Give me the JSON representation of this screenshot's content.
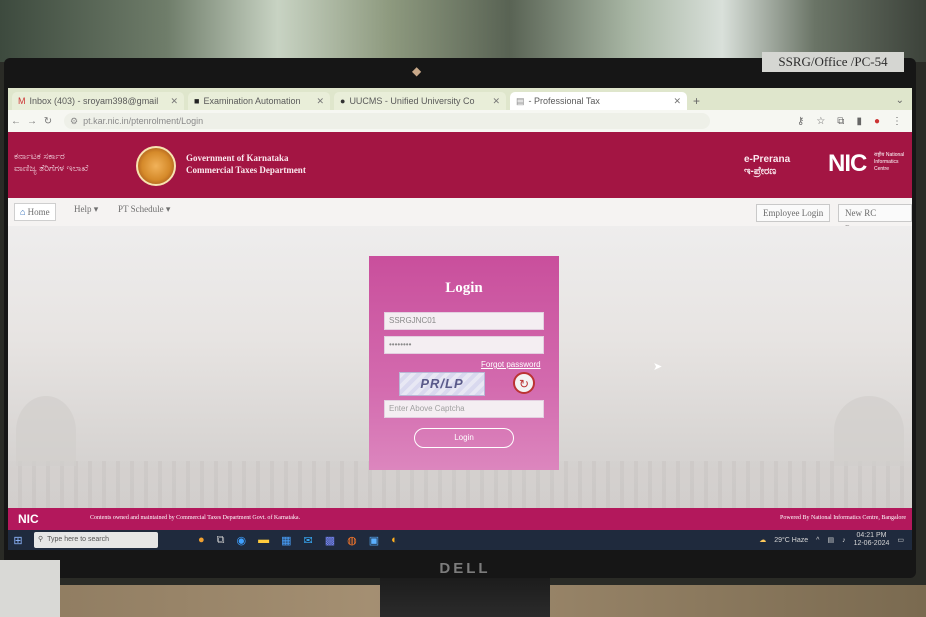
{
  "sticker": "SSRG/Office /PC-54",
  "monitor_brand": "DELL",
  "browser": {
    "tabs": [
      {
        "label": "Inbox (403) - sroyam398@gmail",
        "icon": "M",
        "active": false
      },
      {
        "label": "Examination Automation",
        "icon": "■",
        "active": false
      },
      {
        "label": "UUCMS - Unified University Co",
        "icon": "●",
        "active": false
      },
      {
        "label": "- Professional Tax",
        "icon": "▤",
        "active": true
      }
    ],
    "new_tab": "+",
    "window_controls": "⌄",
    "url": "pt.kar.nic.in/ptenrolment/Login"
  },
  "header": {
    "kannada_title_line1": "ಕರ್ನಾಟಕ ಸರ್ಕಾರ",
    "kannada_title_line2": "ವಾಣಿಜ್ಯ ತೆರಿಗೆಗಳ ಇಲಾಖೆ",
    "gov_line1": "Government of Karnataka",
    "gov_line2": "Commercial Taxes Department",
    "prerana_line1": "e-Prerana",
    "prerana_line2": "ಇ-ಪ್ರೇರಣ",
    "nic": "NIC",
    "nic_sub": "राष्ट्रीय National Informatics Centre"
  },
  "menu": {
    "home": "Home",
    "help": "Help ▾",
    "pt_schedule": "PT Schedule ▾",
    "employee_login": "Employee Login",
    "new_rc_request": "New RC Request"
  },
  "login": {
    "title": "Login",
    "username_value": "SSRGJNC01",
    "password_value": "••••••••",
    "forgot_password": "Forgot password",
    "captcha_text": "PR/LP",
    "captcha_placeholder": "Enter Above Captcha",
    "login_button": "Login"
  },
  "footer": {
    "nic": "NIC",
    "left_text": "Contents owned and maintained by Commercial Taxes Department Govt. of Karnataka.",
    "right_text": "Powered By National Informatics Centre, Bangalore"
  },
  "taskbar": {
    "search_placeholder": "Type here to search",
    "weather": "29°C Haze",
    "time": "04:21 PM",
    "date": "12-06-2024"
  },
  "colors": {
    "header_bg": "#a31543",
    "login_card": "#d36aae",
    "footer_bg": "#b3185c"
  }
}
